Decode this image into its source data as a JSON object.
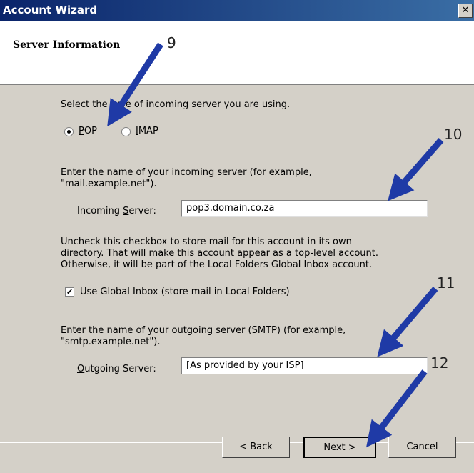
{
  "window": {
    "title": "Account Wizard",
    "close_glyph": "✕"
  },
  "header": {
    "title": "Server Information"
  },
  "server_type": {
    "prompt": "Select the type of incoming server you are using.",
    "options": [
      {
        "label": "POP",
        "selected": true
      },
      {
        "label": "IMAP",
        "selected": false
      }
    ]
  },
  "incoming": {
    "prompt_line1": "Enter the name of your incoming server (for example,",
    "prompt_line2": "\"mail.example.net\").",
    "label": "Incoming Server:",
    "value": "pop3.domain.co.za"
  },
  "global_inbox": {
    "text_line1": "Uncheck this checkbox to store mail for this account in its own",
    "text_line2": "directory. That will make this account appear as a top-level account.",
    "text_line3": "Otherwise, it will be part of the Local Folders Global Inbox account.",
    "checkbox_label": "Use Global Inbox (store mail in Local Folders)",
    "checked": true
  },
  "outgoing": {
    "prompt_line1": "Enter the name of your outgoing server (SMTP) (for example,",
    "prompt_line2": "\"smtp.example.net\").",
    "label": "Outgoing Server:",
    "value": "[As provided by your ISP]"
  },
  "buttons": {
    "back": "< Back",
    "next": "Next >",
    "cancel": "Cancel"
  },
  "annotations": {
    "n9": "9",
    "n10": "10",
    "n11": "11",
    "n12": "12",
    "arrow_color": "#1f3aa6"
  }
}
